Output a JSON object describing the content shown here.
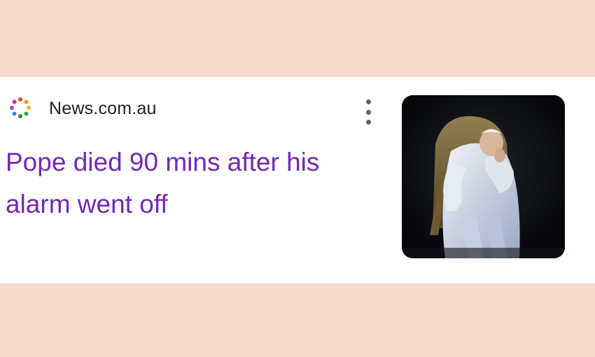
{
  "background_color": "#f5dccc",
  "card": {
    "source": {
      "name": "News.com.au",
      "logo_icon": "newsroom-dots-icon"
    },
    "headline": "Pope died 90 mins after his alarm went off",
    "headline_color": "#7128b3",
    "more_icon": "more-vert-icon",
    "thumbnail": {
      "description_icon": "news-photo"
    }
  }
}
